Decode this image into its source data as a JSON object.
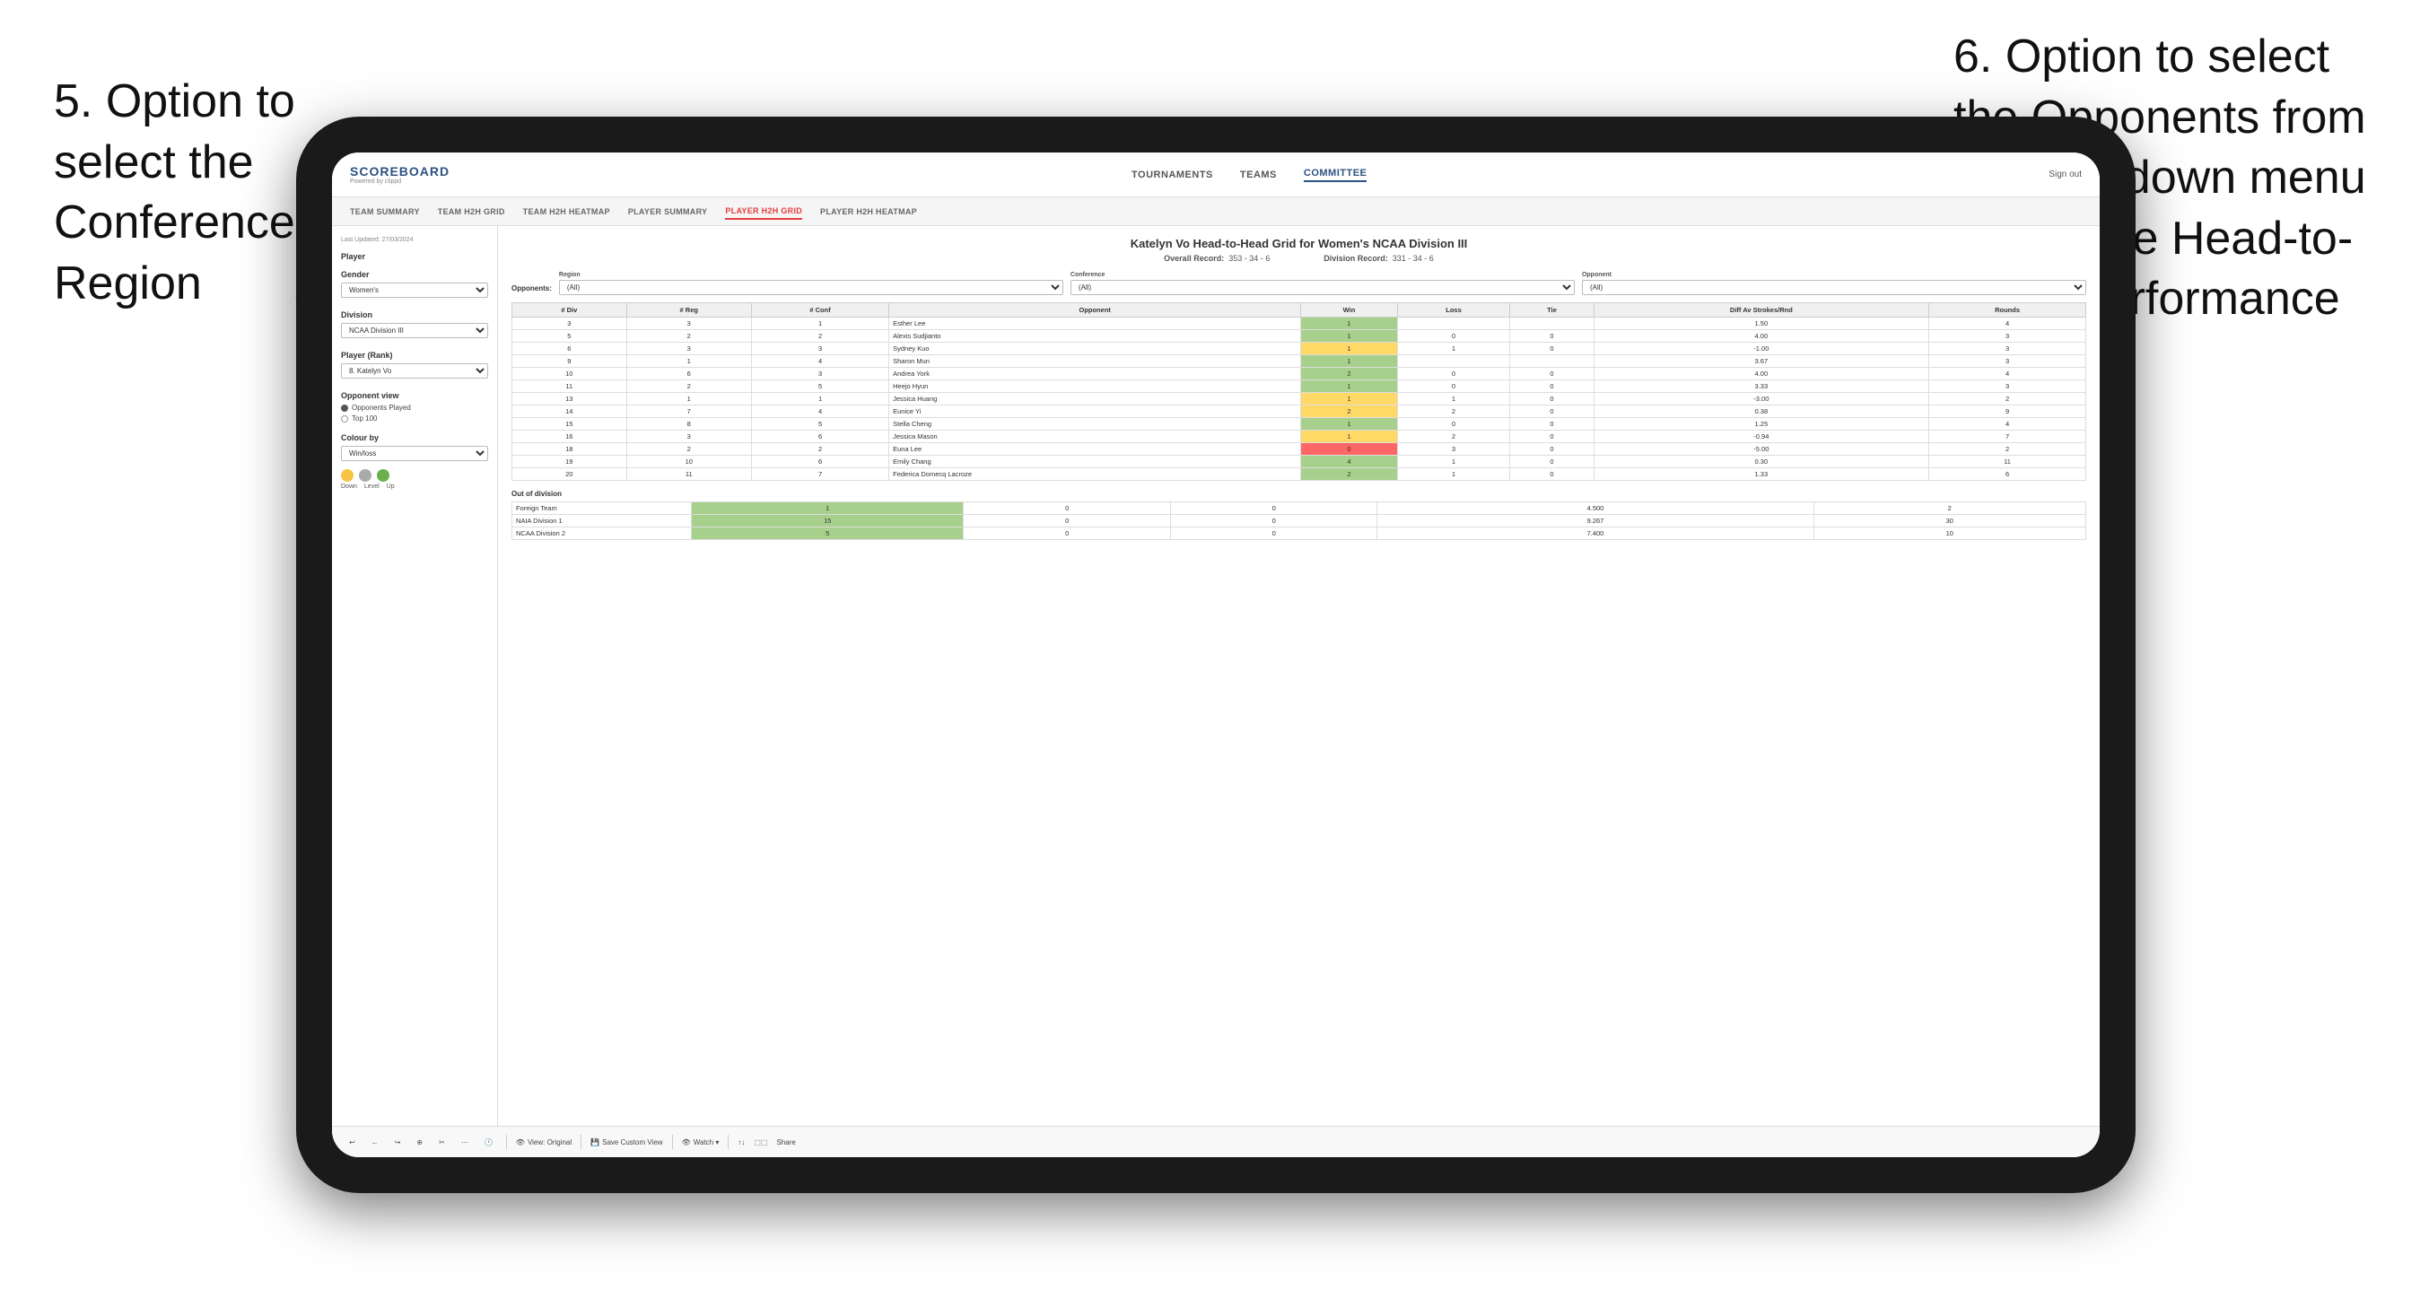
{
  "annotations": {
    "left": {
      "text": "5. Option to select the Conference and Region"
    },
    "right": {
      "text": "6. Option to select the Opponents from the dropdown menu to see the Head-to-Head performance"
    }
  },
  "nav": {
    "logo": "SCOREBOARD",
    "logo_sub": "Powered by clippd",
    "items": [
      "TOURNAMENTS",
      "TEAMS",
      "COMMITTEE"
    ],
    "active_item": "COMMITTEE",
    "right_links": [
      "Sign out"
    ]
  },
  "sub_nav": {
    "items": [
      "TEAM SUMMARY",
      "TEAM H2H GRID",
      "TEAM H2H HEATMAP",
      "PLAYER SUMMARY",
      "PLAYER H2H GRID",
      "PLAYER H2H HEATMAP"
    ],
    "active_item": "PLAYER H2H GRID"
  },
  "sidebar": {
    "last_updated_label": "Last Updated: 27/03/2024",
    "last_updated_sub": "04",
    "player_label": "Player",
    "gender_label": "Gender",
    "gender_value": "Women's",
    "division_label": "Division",
    "division_value": "NCAA Division III",
    "player_rank_label": "Player (Rank)",
    "player_rank_value": "8. Katelyn Vo",
    "opponent_view_label": "Opponent view",
    "opponent_options": [
      "Opponents Played",
      "Top 100"
    ],
    "opponent_selected": "Opponents Played",
    "colour_by_label": "Colour by",
    "colour_by_value": "Win/loss",
    "legend_labels": [
      "Down",
      "Level",
      "Up"
    ]
  },
  "main": {
    "title": "Katelyn Vo Head-to-Head Grid for Women's NCAA Division III",
    "overall_record_label": "Overall Record:",
    "overall_record_value": "353 - 34 - 6",
    "division_record_label": "Division Record:",
    "division_record_value": "331 - 34 - 6",
    "filters": {
      "opponents_label": "Opponents:",
      "region_label": "Region",
      "region_value": "(All)",
      "conference_label": "Conference",
      "conference_value": "(All)",
      "opponent_label": "Opponent",
      "opponent_value": "(All)"
    },
    "table": {
      "headers": [
        "# Div",
        "# Reg",
        "# Conf",
        "Opponent",
        "Win",
        "Loss",
        "Tie",
        "Diff Av Strokes/Rnd",
        "Rounds"
      ],
      "rows": [
        {
          "div": "3",
          "reg": "3",
          "conf": "1",
          "opponent": "Esther Lee",
          "win": "1",
          "loss": "",
          "tie": "",
          "diff": "1.50",
          "rounds": "4",
          "win_color": "green"
        },
        {
          "div": "5",
          "reg": "2",
          "conf": "2",
          "opponent": "Alexis Sudjianto",
          "win": "1",
          "loss": "0",
          "tie": "0",
          "diff": "4.00",
          "rounds": "3",
          "win_color": "green"
        },
        {
          "div": "6",
          "reg": "3",
          "conf": "3",
          "opponent": "Sydney Kuo",
          "win": "1",
          "loss": "1",
          "tie": "0",
          "diff": "-1.00",
          "rounds": "3",
          "win_color": "yellow"
        },
        {
          "div": "9",
          "reg": "1",
          "conf": "4",
          "opponent": "Sharon Mun",
          "win": "1",
          "loss": "",
          "tie": "",
          "diff": "3.67",
          "rounds": "3",
          "win_color": "green"
        },
        {
          "div": "10",
          "reg": "6",
          "conf": "3",
          "opponent": "Andrea York",
          "win": "2",
          "loss": "0",
          "tie": "0",
          "diff": "4.00",
          "rounds": "4",
          "win_color": "green"
        },
        {
          "div": "11",
          "reg": "2",
          "conf": "5",
          "opponent": "Heejo Hyun",
          "win": "1",
          "loss": "0",
          "tie": "0",
          "diff": "3.33",
          "rounds": "3",
          "win_color": "green"
        },
        {
          "div": "13",
          "reg": "1",
          "conf": "1",
          "opponent": "Jessica Huang",
          "win": "1",
          "loss": "1",
          "tie": "0",
          "diff": "-3.00",
          "rounds": "2",
          "win_color": "yellow"
        },
        {
          "div": "14",
          "reg": "7",
          "conf": "4",
          "opponent": "Eunice Yi",
          "win": "2",
          "loss": "2",
          "tie": "0",
          "diff": "0.38",
          "rounds": "9",
          "win_color": "yellow"
        },
        {
          "div": "15",
          "reg": "8",
          "conf": "5",
          "opponent": "Stella Cheng",
          "win": "1",
          "loss": "0",
          "tie": "0",
          "diff": "1.25",
          "rounds": "4",
          "win_color": "green"
        },
        {
          "div": "16",
          "reg": "3",
          "conf": "6",
          "opponent": "Jessica Mason",
          "win": "1",
          "loss": "2",
          "tie": "0",
          "diff": "-0.94",
          "rounds": "7",
          "win_color": "yellow"
        },
        {
          "div": "18",
          "reg": "2",
          "conf": "2",
          "opponent": "Euna Lee",
          "win": "0",
          "loss": "3",
          "tie": "0",
          "diff": "-5.00",
          "rounds": "2",
          "win_color": "red"
        },
        {
          "div": "19",
          "reg": "10",
          "conf": "6",
          "opponent": "Emily Chang",
          "win": "4",
          "loss": "1",
          "tie": "0",
          "diff": "0.30",
          "rounds": "11",
          "win_color": "green"
        },
        {
          "div": "20",
          "reg": "11",
          "conf": "7",
          "opponent": "Federica Domecq Lacroze",
          "win": "2",
          "loss": "1",
          "tie": "0",
          "diff": "1.33",
          "rounds": "6",
          "win_color": "green"
        }
      ],
      "out_of_division_label": "Out of division",
      "out_rows": [
        {
          "opponent": "Foreign Team",
          "win": "1",
          "loss": "0",
          "tie": "0",
          "diff": "4.500",
          "rounds": "2",
          "win_color": "green"
        },
        {
          "opponent": "NAIA Division 1",
          "win": "15",
          "loss": "0",
          "tie": "0",
          "diff": "9.267",
          "rounds": "30",
          "win_color": "green"
        },
        {
          "opponent": "NCAA Division 2",
          "win": "5",
          "loss": "0",
          "tie": "0",
          "diff": "7.400",
          "rounds": "10",
          "win_color": "green"
        }
      ]
    }
  },
  "toolbar": {
    "buttons": [
      "↩",
      "←",
      "↪",
      "⊕",
      "✂",
      "⋯",
      "🕐"
    ],
    "actions": [
      "View: Original",
      "Save Custom View",
      "Watch ▾",
      "↑↓",
      "⬚⬚",
      "Share"
    ]
  }
}
